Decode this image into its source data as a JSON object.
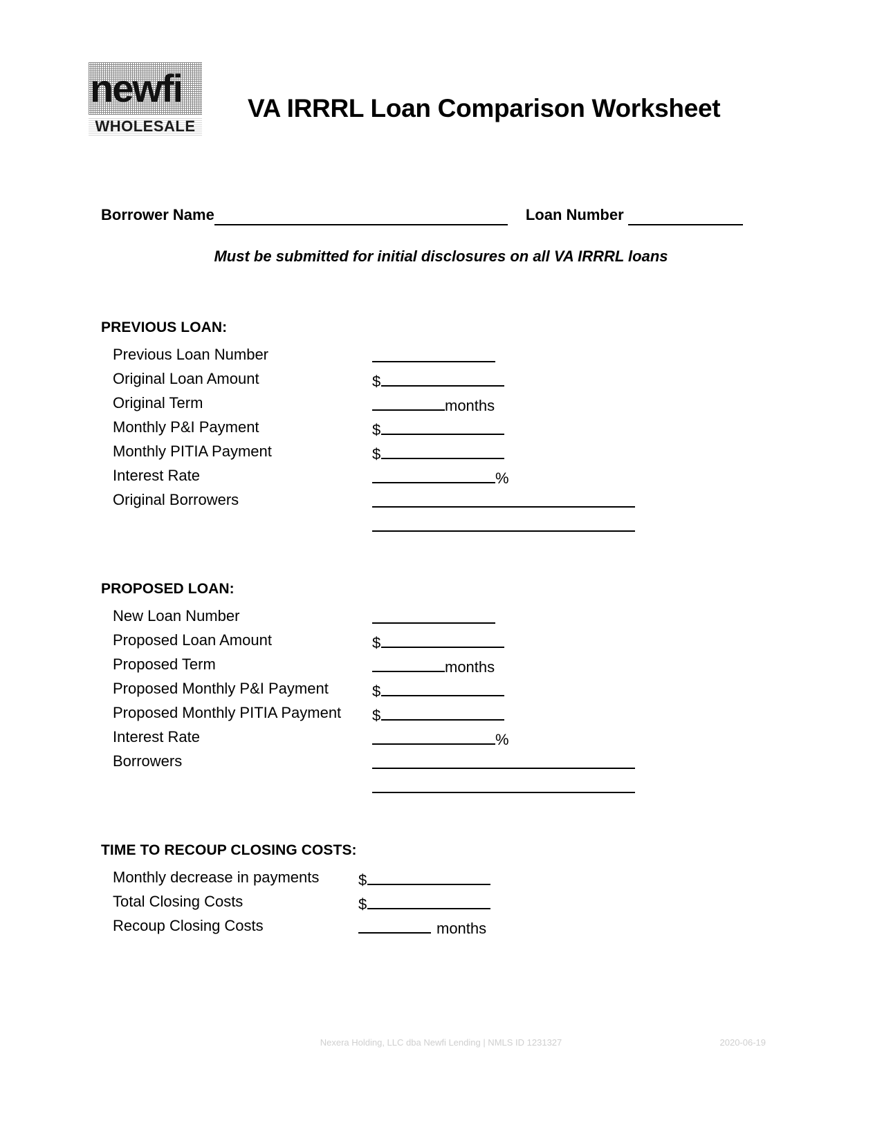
{
  "logo": {
    "wordmark": "newfi",
    "subtitle": "WHOLESALE"
  },
  "header": {
    "title": "VA IRRRL Loan Comparison Worksheet"
  },
  "identity": {
    "borrower_name_label": "Borrower Name",
    "loan_number_label": "Loan Number"
  },
  "notice": {
    "text": "Must be submitted for initial disclosures on all VA IRRRL loans"
  },
  "sections": [
    {
      "heading": "PREVIOUS LOAN:",
      "rows": [
        {
          "label": "Previous Loan Number",
          "prefix": "",
          "blank": "short",
          "unit": ""
        },
        {
          "label": "Original Loan Amount",
          "prefix": "$",
          "blank": "short",
          "unit": ""
        },
        {
          "label": "Original Term",
          "prefix": "",
          "blank": "term",
          "unit": "months"
        },
        {
          "label": "Monthly P&I Payment",
          "prefix": "$",
          "blank": "short",
          "unit": ""
        },
        {
          "label": "Monthly PITIA Payment",
          "prefix": "$",
          "blank": "short",
          "unit": ""
        },
        {
          "label": "Interest Rate",
          "prefix": "",
          "blank": "short",
          "unit": "%"
        },
        {
          "label": "Original Borrowers",
          "prefix": "",
          "blank": "long",
          "unit": ""
        },
        {
          "label": "",
          "prefix": "",
          "blank": "long",
          "unit": ""
        }
      ]
    },
    {
      "heading": "PROPOSED LOAN:",
      "rows": [
        {
          "label": "New Loan Number",
          "prefix": "",
          "blank": "short",
          "unit": ""
        },
        {
          "label": "Proposed Loan Amount",
          "prefix": "$",
          "blank": "short",
          "unit": ""
        },
        {
          "label": "Proposed Term",
          "prefix": "",
          "blank": "term",
          "unit": "months"
        },
        {
          "label": "Proposed Monthly P&I Payment",
          "prefix": "$",
          "blank": "short",
          "unit": ""
        },
        {
          "label": "Proposed Monthly PITIA Payment",
          "prefix": "$",
          "blank": "short",
          "unit": ""
        },
        {
          "label": "Interest Rate",
          "prefix": "",
          "blank": "short",
          "unit": "%"
        },
        {
          "label": "Borrowers",
          "prefix": "",
          "blank": "long",
          "unit": ""
        },
        {
          "label": "",
          "prefix": "",
          "blank": "long",
          "unit": ""
        }
      ]
    },
    {
      "heading": "TIME TO RECOUP CLOSING COSTS:",
      "rows": [
        {
          "label": "Monthly decrease in payments",
          "prefix": "$",
          "blank": "short",
          "unit": ""
        },
        {
          "label": "Total Closing Costs",
          "prefix": "$",
          "blank": "short",
          "unit": ""
        },
        {
          "label": "Recoup Closing Costs",
          "prefix": "",
          "blank": "term",
          "unit": " months"
        }
      ]
    }
  ],
  "footer": {
    "legal": "Nexera Holding, LLC dba Newfi Lending | NMLS ID 1231327",
    "date": "2020-06-19"
  }
}
